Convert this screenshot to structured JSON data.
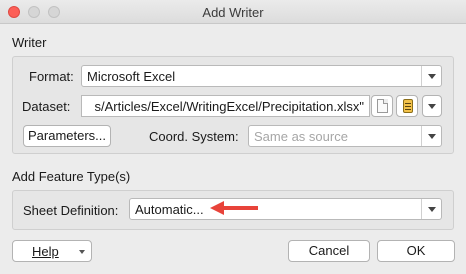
{
  "window": {
    "title": "Add Writer"
  },
  "writer_section": {
    "label": "Writer",
    "format_label": "Format:",
    "format_value": "Microsoft Excel",
    "dataset_label": "Dataset:",
    "dataset_value": "s/Articles/Excel/WritingExcel/Precipitation.xlsx\"",
    "parameters_button": "Parameters...",
    "coord_label": "Coord. System:",
    "coord_value": "Same as source"
  },
  "feature_section": {
    "label": "Add Feature Type(s)",
    "sheet_label": "Sheet Definition:",
    "sheet_value": "Automatic..."
  },
  "footer": {
    "help": "Help",
    "cancel": "Cancel",
    "ok": "OK"
  },
  "colors": {
    "arrow": "#e8433a",
    "close": "#fc5f57"
  }
}
